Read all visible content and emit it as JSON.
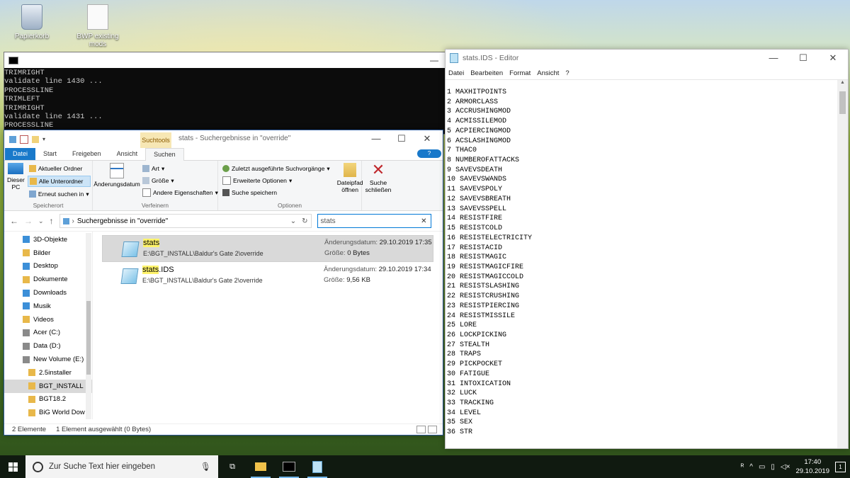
{
  "desktop": {
    "icons": [
      {
        "label": "Papierkorb"
      },
      {
        "label": "BWP existing mods"
      }
    ]
  },
  "console": {
    "lines": [
      "TRIMRIGHT",
      "validate line 1430 ...",
      "PROCESSLINE",
      "TRIMLEFT",
      "TRIMRIGHT",
      "validate line 1431 ...",
      "PROCESSLINE"
    ],
    "minimize": "—"
  },
  "explorer": {
    "contextual_tab": "Suchtools",
    "title": "stats - Suchergebnisse in \"override\"",
    "tabs": [
      "Datei",
      "Start",
      "Freigeben",
      "Ansicht",
      "Suchen"
    ],
    "help": "?",
    "ribbon": {
      "this_pc": "Dieser PC",
      "current_folder": "Aktueller Ordner",
      "all_subfolders": "Alle Unterordner",
      "search_again": "Erneut suchen in",
      "group_location": "Speicherort",
      "date_modified": "Änderungsdatum",
      "kind": "Art",
      "size": "Größe",
      "other_props": "Andere Eigenschaften",
      "group_refine": "Verfeinern",
      "recent": "Zuletzt ausgeführte Suchvorgänge",
      "advanced": "Erweiterte Optionen",
      "save_search": "Suche speichern",
      "open_path": "Dateipfad öffnen",
      "group_options": "Optionen",
      "close_search": "Suche schließen"
    },
    "address": "Suchergebnisse in \"override\"",
    "search_value": "stats",
    "nav": [
      {
        "label": "3D-Objekte",
        "icon": "folder-3d-icon",
        "color": "#3c8fd8"
      },
      {
        "label": "Bilder",
        "icon": "pictures-folder-icon",
        "color": "#e8b84a"
      },
      {
        "label": "Desktop",
        "icon": "desktop-folder-icon",
        "color": "#3c8fd8"
      },
      {
        "label": "Dokumente",
        "icon": "documents-folder-icon",
        "color": "#e8b84a"
      },
      {
        "label": "Downloads",
        "icon": "downloads-folder-icon",
        "color": "#3c8fd8"
      },
      {
        "label": "Musik",
        "icon": "music-folder-icon",
        "color": "#3c8fd8"
      },
      {
        "label": "Videos",
        "icon": "videos-folder-icon",
        "color": "#e8b84a"
      },
      {
        "label": "Acer (C:)",
        "icon": "drive-icon",
        "color": "#8a8a8a"
      },
      {
        "label": "Data (D:)",
        "icon": "drive-icon",
        "color": "#8a8a8a"
      },
      {
        "label": "New Volume (E:)",
        "icon": "drive-icon",
        "color": "#8a8a8a"
      },
      {
        "label": "2.5installer",
        "icon": "folder-icon",
        "color": "#e8b84a"
      },
      {
        "label": "BGT_INSTALL",
        "icon": "folder-icon",
        "color": "#e8b84a"
      },
      {
        "label": "BGT18.2",
        "icon": "folder-icon",
        "color": "#e8b84a"
      },
      {
        "label": "BiG World Dow",
        "icon": "folder-icon",
        "color": "#e8b84a"
      }
    ],
    "results": [
      {
        "name_highlight": "stats",
        "name_rest": "",
        "path": "E:\\BGT_INSTALL\\Baldur's Gate 2\\override",
        "date_label": "Änderungsdatum:",
        "date": "29.10.2019 17:35",
        "size_label": "Größe:",
        "size": "0 Bytes"
      },
      {
        "name_highlight": "stats",
        "name_rest": ".IDS",
        "path": "E:\\BGT_INSTALL\\Baldur's Gate 2\\override",
        "date_label": "Änderungsdatum:",
        "date": "29.10.2019 17:34",
        "size_label": "Größe:",
        "size": "9,56 KB"
      }
    ],
    "status_count": "2 Elemente",
    "status_selected": "1 Element ausgewählt (0 Bytes)"
  },
  "notepad": {
    "title": "stats.IDS - Editor",
    "menu": [
      "Datei",
      "Bearbeiten",
      "Format",
      "Ansicht",
      "?"
    ],
    "lines": [
      "1 MAXHITPOINTS",
      "2 ARMORCLASS",
      "3 ACCRUSHINGMOD",
      "4 ACMISSILEMOD",
      "5 ACPIERCINGMOD",
      "6 ACSLASHINGMOD",
      "7 THAC0",
      "8 NUMBEROFATTACKS",
      "9 SAVEVSDEATH",
      "10 SAVEVSWANDS",
      "11 SAVEVSPOLY",
      "12 SAVEVSBREATH",
      "13 SAVEVSSPELL",
      "14 RESISTFIRE",
      "15 RESISTCOLD",
      "16 RESISTELECTRICITY",
      "17 RESISTACID",
      "18 RESISTMAGIC",
      "19 RESISTMAGICFIRE",
      "20 RESISTMAGICCOLD",
      "21 RESISTSLASHING",
      "22 RESISTCRUSHING",
      "23 RESISTPIERCING",
      "24 RESISTMISSILE",
      "25 LORE",
      "26 LOCKPICKING",
      "27 STEALTH",
      "28 TRAPS",
      "29 PICKPOCKET",
      "30 FATIGUE",
      "31 INTOXICATION",
      "32 LUCK",
      "33 TRACKING",
      "34 LEVEL",
      "35 SEX",
      "36 STR"
    ]
  },
  "taskbar": {
    "search_placeholder": "Zur Suche Text hier eingeben",
    "time": "17:40",
    "date": "29.10.2019",
    "notifications": "1",
    "accent": "#76b9ed"
  }
}
